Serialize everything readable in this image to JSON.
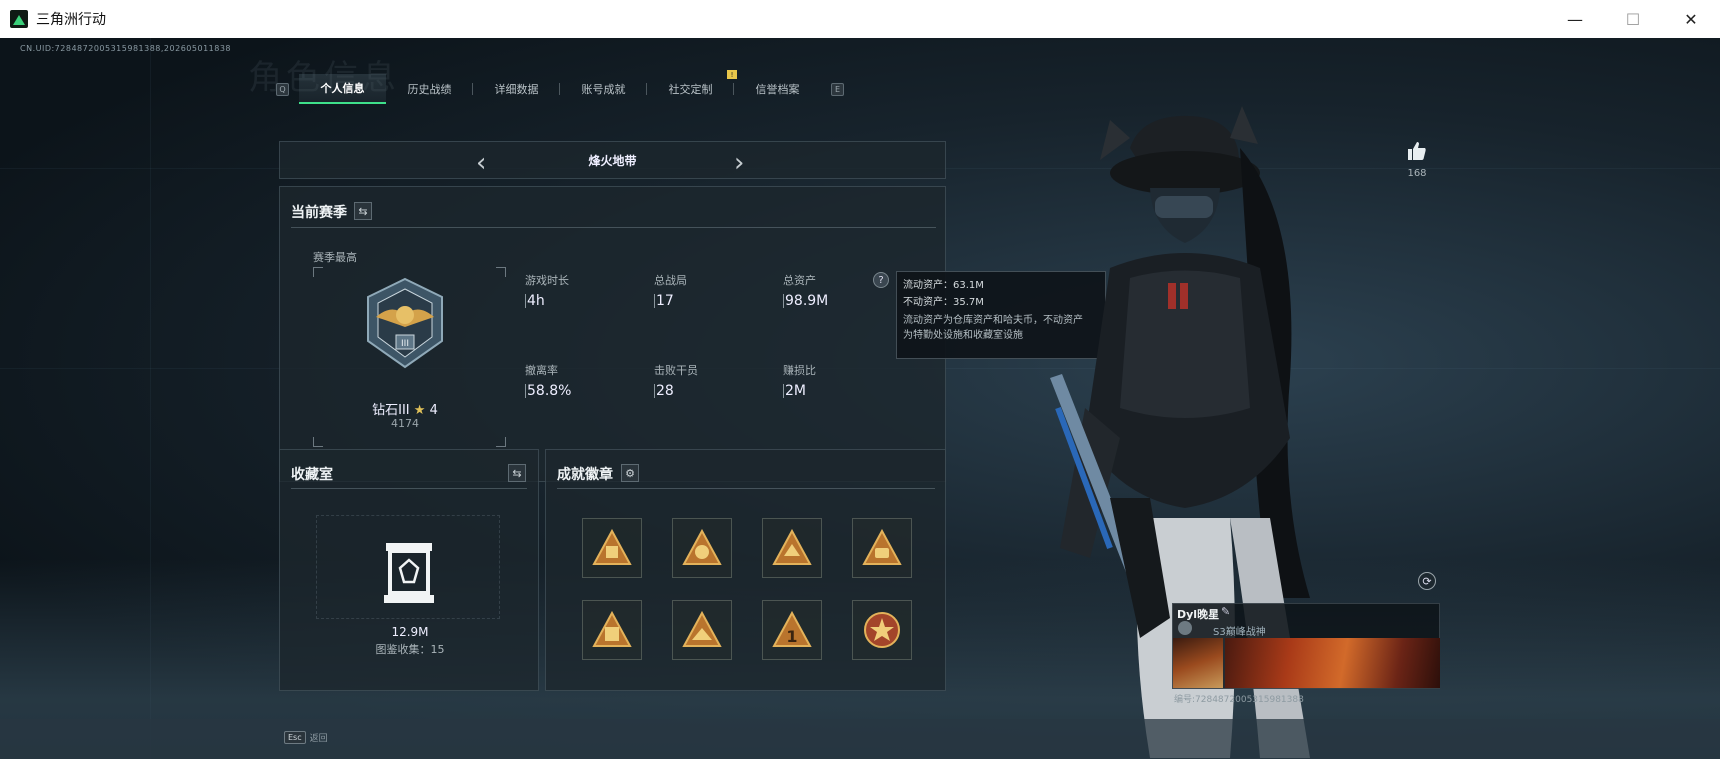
{
  "window": {
    "title": "三角洲行动",
    "minimize_label": "—",
    "maximize_label": "☐",
    "close_label": "✕"
  },
  "uid_text": "CN.UID:7284872005315981388,202605011838",
  "bg_title": "角色信息",
  "tabs": {
    "left_key": "Q",
    "right_key": "E",
    "items": [
      {
        "label": "个人信息",
        "active": true
      },
      {
        "label": "历史战绩"
      },
      {
        "label": "详细数据"
      },
      {
        "label": "账号成就"
      },
      {
        "label": "社交定制"
      },
      {
        "label": "信誉档案"
      }
    ],
    "badge": "!"
  },
  "mode": {
    "name": "烽火地带",
    "prev": "‹",
    "next": "›"
  },
  "season": {
    "title": "当前赛季",
    "switch_icon": "swap-icon",
    "best_label": "赛季最高",
    "rank_name": "钻石III",
    "rank_stars": "4",
    "rank_score": "4174",
    "stats": [
      {
        "label": "游戏时长",
        "value": "4h"
      },
      {
        "label": "总战局",
        "value": "17"
      },
      {
        "label": "总资产",
        "value": "98.9M"
      },
      {
        "label": "撤离率",
        "value": "58.8%"
      },
      {
        "label": "击败干员",
        "value": "28"
      },
      {
        "label": "赚损比",
        "value": "2M"
      }
    ]
  },
  "tooltip": {
    "liquid": "流动资产：63.1M",
    "fixed": "不动资产：35.7M",
    "desc1": "流动资产为仓库资产和哈夫币，不动资产",
    "desc2": "为特勤处设施和收藏室设施"
  },
  "collection": {
    "title": "收藏室",
    "value": "12.9M",
    "sub": "图鉴收集：15"
  },
  "badges": {
    "title": "成就徽章",
    "settings_icon": "gear-icon",
    "items": [
      "badge-1",
      "badge-2",
      "badge-3",
      "badge-4",
      "badge-5",
      "badge-6",
      "badge-7",
      "badge-8"
    ]
  },
  "likes": {
    "count": "168",
    "icon": "thumbs-up-icon"
  },
  "card": {
    "name": "Dyl晚星",
    "title": "S3巅峰战神",
    "id": "编号:7284872005315981388"
  },
  "bottom": {
    "esc_key": "Esc",
    "esc_label": "返回"
  },
  "colors": {
    "accent_green": "#3ee08a",
    "gold": "#d4a24a"
  }
}
